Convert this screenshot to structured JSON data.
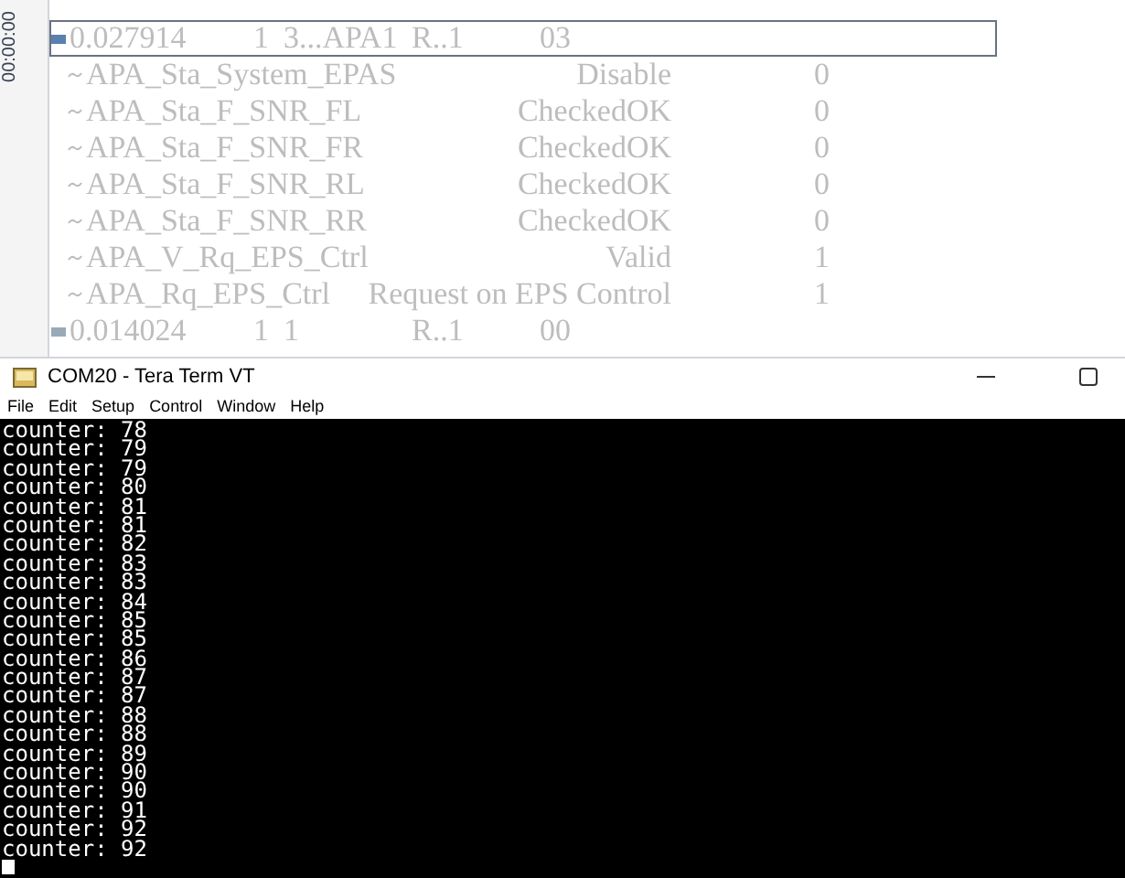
{
  "trace": {
    "time_axis_label": "00:00:00",
    "messages": [
      {
        "time": "0.027914",
        "column_2": "1",
        "column_3": "3...APA1",
        "column_4": "R..1",
        "column_5": "03",
        "selected": true,
        "expanded": true,
        "signals": [
          {
            "name": "APA_Sta_System_EPAS",
            "value": "Disable",
            "raw": "0"
          },
          {
            "name": "APA_Sta_F_SNR_FL",
            "value": "CheckedOK",
            "raw": "0"
          },
          {
            "name": "APA_Sta_F_SNR_FR",
            "value": "CheckedOK",
            "raw": "0"
          },
          {
            "name": "APA_Sta_F_SNR_RL",
            "value": "CheckedOK",
            "raw": "0"
          },
          {
            "name": "APA_Sta_F_SNR_RR",
            "value": "CheckedOK",
            "raw": "0"
          },
          {
            "name": "APA_V_Rq_EPS_Ctrl",
            "value": "Valid",
            "raw": "1"
          },
          {
            "name": "APA_Rq_EPS_Ctrl",
            "value": "Request on EPS Control",
            "raw": "1"
          }
        ]
      },
      {
        "time": "0.014024",
        "column_2": "1",
        "column_3": "1",
        "column_4": "R..1",
        "column_5": "00",
        "selected": false,
        "expanded": false
      }
    ]
  },
  "terminal": {
    "title": "COM20 - Tera Term VT",
    "menu": [
      "File",
      "Edit",
      "Setup",
      "Control",
      "Window",
      "Help"
    ],
    "lines": [
      "counter: 78",
      "counter: 79",
      "counter: 79",
      "counter: 80",
      "counter: 81",
      "counter: 81",
      "counter: 82",
      "counter: 83",
      "counter: 83",
      "counter: 84",
      "counter: 85",
      "counter: 85",
      "counter: 86",
      "counter: 87",
      "counter: 87",
      "counter: 88",
      "counter: 88",
      "counter: 89",
      "counter: 90",
      "counter: 90",
      "counter: 91",
      "counter: 92",
      "counter: 92"
    ]
  }
}
